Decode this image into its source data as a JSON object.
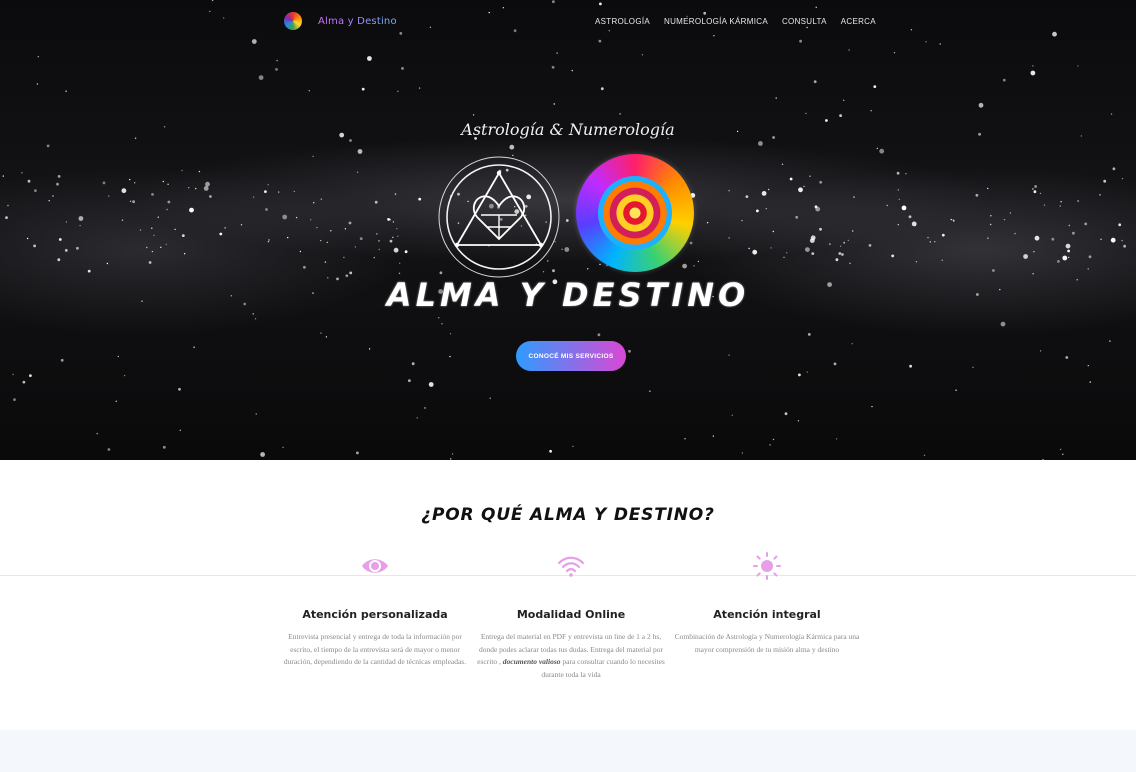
{
  "nav": {
    "brand": "Alma y Destino",
    "links": [
      "ASTROLOGÍA",
      "NUMEROLOGÍA KÁRMICA",
      "CONSULTA",
      "ACERCA"
    ]
  },
  "hero": {
    "subtitle": "Astrología & Numerología",
    "title": "ALMA Y DESTINO",
    "cta": "CONOCÉ MIS SERVICIOS"
  },
  "features": {
    "heading": "¿POR QUÉ ALMA Y DESTINO?",
    "items": [
      {
        "icon": "eye-icon",
        "title": "Atención personalizada",
        "text": "Entrevista presencial y entrega de toda la información por escrito, el tiempo de la entrevista será de mayor o menor duración, dependiendo de la cantidad de técnicas empleadas."
      },
      {
        "icon": "wifi-icon",
        "title": "Modalidad Online",
        "text_before": "Entrega del material en PDF y entrevista on line de 1 a 2 hs, donde podes aclarar todas tus dudas. Entrega del material por escrito ,",
        "text_emphasis": "documento valioso",
        "text_after": "para consultar cuando lo necesites durante toda la vida"
      },
      {
        "icon": "sun-icon",
        "title": "Atención integral",
        "text": "Combinación de Astrología y Numerología Kármica para una mayor comprensión de tu misión alma y destino"
      }
    ]
  },
  "colors": {
    "accent_blue": "#2f9bff",
    "accent_pink": "#d948d4",
    "icon_pink": "#e7a0e8"
  }
}
